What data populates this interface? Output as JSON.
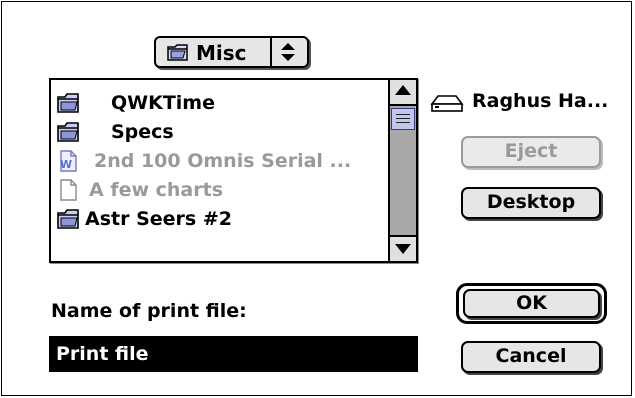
{
  "dialog": {
    "folder_popup": {
      "label": "Misc"
    },
    "files": [
      {
        "name": "QWKTime",
        "kind": "folder",
        "enabled": true
      },
      {
        "name": "Specs",
        "kind": "folder",
        "enabled": true
      },
      {
        "name": "2nd 100 Omnis Serial ...",
        "kind": "document",
        "enabled": false
      },
      {
        "name": "A few charts",
        "kind": "document",
        "enabled": false
      },
      {
        "name": "Astr Seers #2",
        "kind": "folder",
        "enabled": true
      }
    ],
    "volume": {
      "name": "Raghus Ha..."
    },
    "buttons": {
      "eject": "Eject",
      "desktop": "Desktop",
      "ok": "OK",
      "cancel": "Cancel"
    },
    "name_field": {
      "label": "Name of print file:",
      "value": "Print file"
    },
    "scroll_position": 0.05
  },
  "icons": {
    "popup_folder": "folder-icon",
    "popup_arrows": "updown-arrows-icon",
    "folder": "folder-icon",
    "document": "document-icon",
    "volume": "hard-disk-icon",
    "scroll_up": "up-arrow-icon",
    "scroll_down": "down-arrow-icon"
  },
  "colors": {
    "thumb": "#bfc7ee",
    "scroll_track": "#a8a8a8",
    "disabled_text": "#9a9a9a"
  }
}
